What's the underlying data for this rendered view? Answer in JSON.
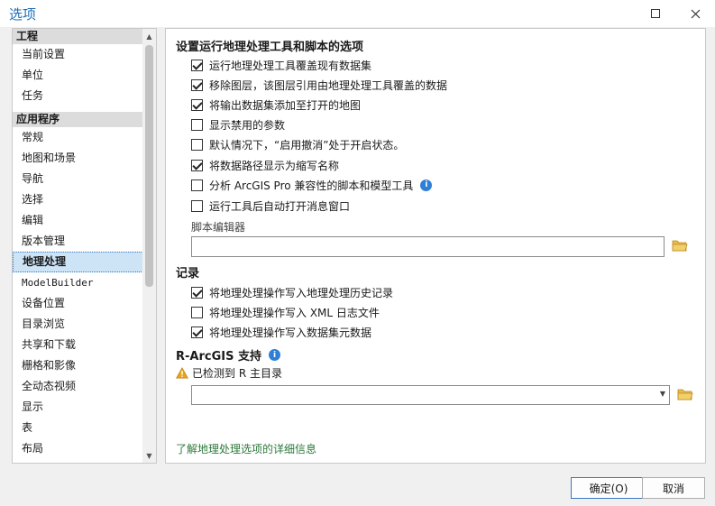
{
  "window": {
    "title": "选项"
  },
  "nav": {
    "groups": [
      {
        "label": "工程",
        "items": [
          "当前设置",
          "单位",
          "任务"
        ]
      },
      {
        "label": "应用程序",
        "items": [
          "常规",
          "地图和场景",
          "导航",
          "选择",
          "编辑",
          "版本管理",
          "地理处理",
          "ModelBuilder",
          "设备位置",
          "目录浏览",
          "共享和下载",
          "栅格和影像",
          "全动态视频",
          "显示",
          "表",
          "布局"
        ]
      }
    ],
    "selected": "地理处理"
  },
  "panel": {
    "section1_title": "设置运行地理处理工具和脚本的选项",
    "options1": [
      {
        "label": "运行地理处理工具覆盖现有数据集",
        "checked": true
      },
      {
        "label": "移除图层，该图层引用由地理处理工具覆盖的数据",
        "checked": true
      },
      {
        "label": "将输出数据集添加至打开的地图",
        "checked": true
      },
      {
        "label": "显示禁用的参数",
        "checked": false
      },
      {
        "label": "默认情况下，“启用撤消”处于开启状态。",
        "checked": false
      },
      {
        "label": "将数据路径显示为缩写名称",
        "checked": true
      },
      {
        "label": "分析 ArcGIS Pro 兼容性的脚本和模型工具",
        "checked": false
      },
      {
        "label": "运行工具后自动打开消息窗口",
        "checked": false
      }
    ],
    "script_editor_label": "脚本编辑器",
    "script_editor_value": "",
    "section2_title": "记录",
    "options2": [
      {
        "label": "将地理处理操作写入地理处理历史记录",
        "checked": true
      },
      {
        "label": "将地理处理操作写入 XML 日志文件",
        "checked": false
      },
      {
        "label": "将地理处理操作写入数据集元数据",
        "checked": true
      }
    ],
    "section3_title": "R-ArcGIS 支持",
    "r_warning": "已检测到 R 主目录",
    "r_home_value": "",
    "learn_more_link": "了解地理处理选项的详细信息"
  },
  "buttons": {
    "ok": "确定(O)",
    "cancel": "取消"
  },
  "colors": {
    "accent": "#1f6fb5",
    "info": "#2f7fd6",
    "link": "#2d7a3a",
    "warning": "#e8a317",
    "folder": "#e9b949"
  }
}
